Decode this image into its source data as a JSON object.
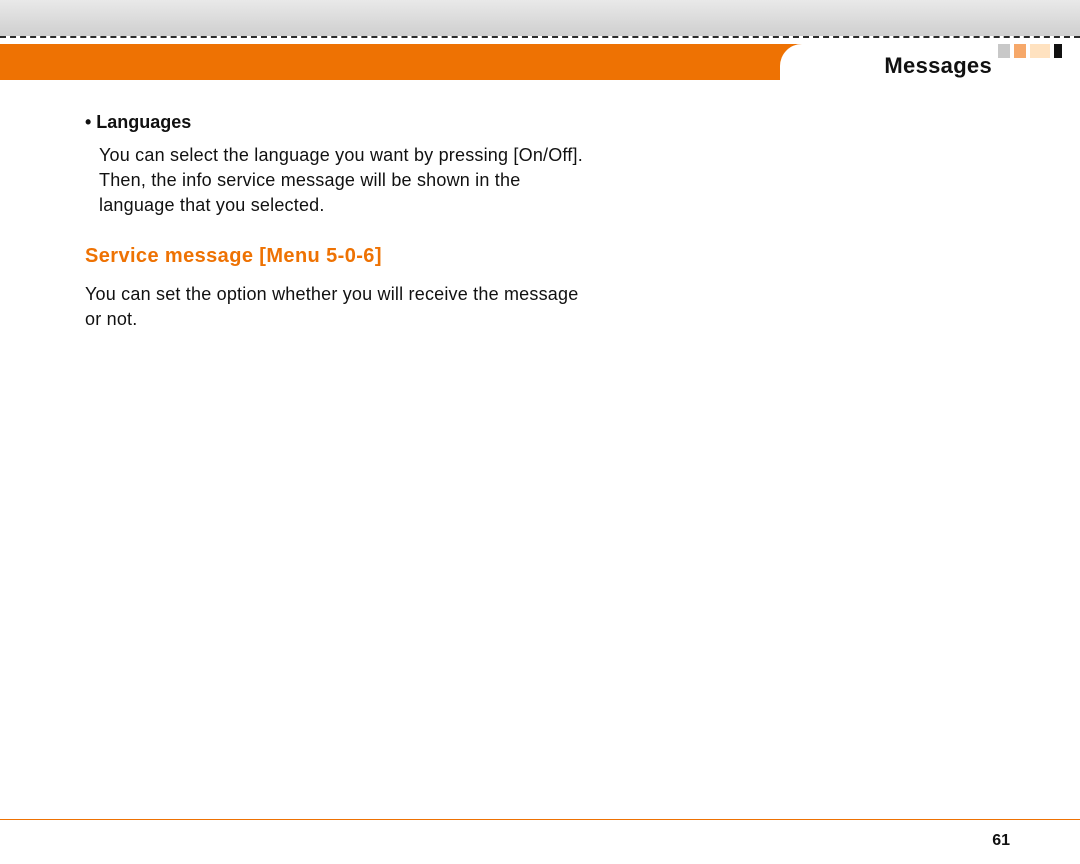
{
  "header": {
    "page_title": "Messages"
  },
  "content": {
    "bullet_heading": "• Languages",
    "languages_body": "You can select the language you want by pressing [On/Off]. Then, the info service message will be shown in the language that you selected.",
    "service_message_title": "Service message [Menu 5-0-6]",
    "service_message_body": "You can set the option whether you will receive the message or not."
  },
  "footer": {
    "page_number": "61"
  }
}
